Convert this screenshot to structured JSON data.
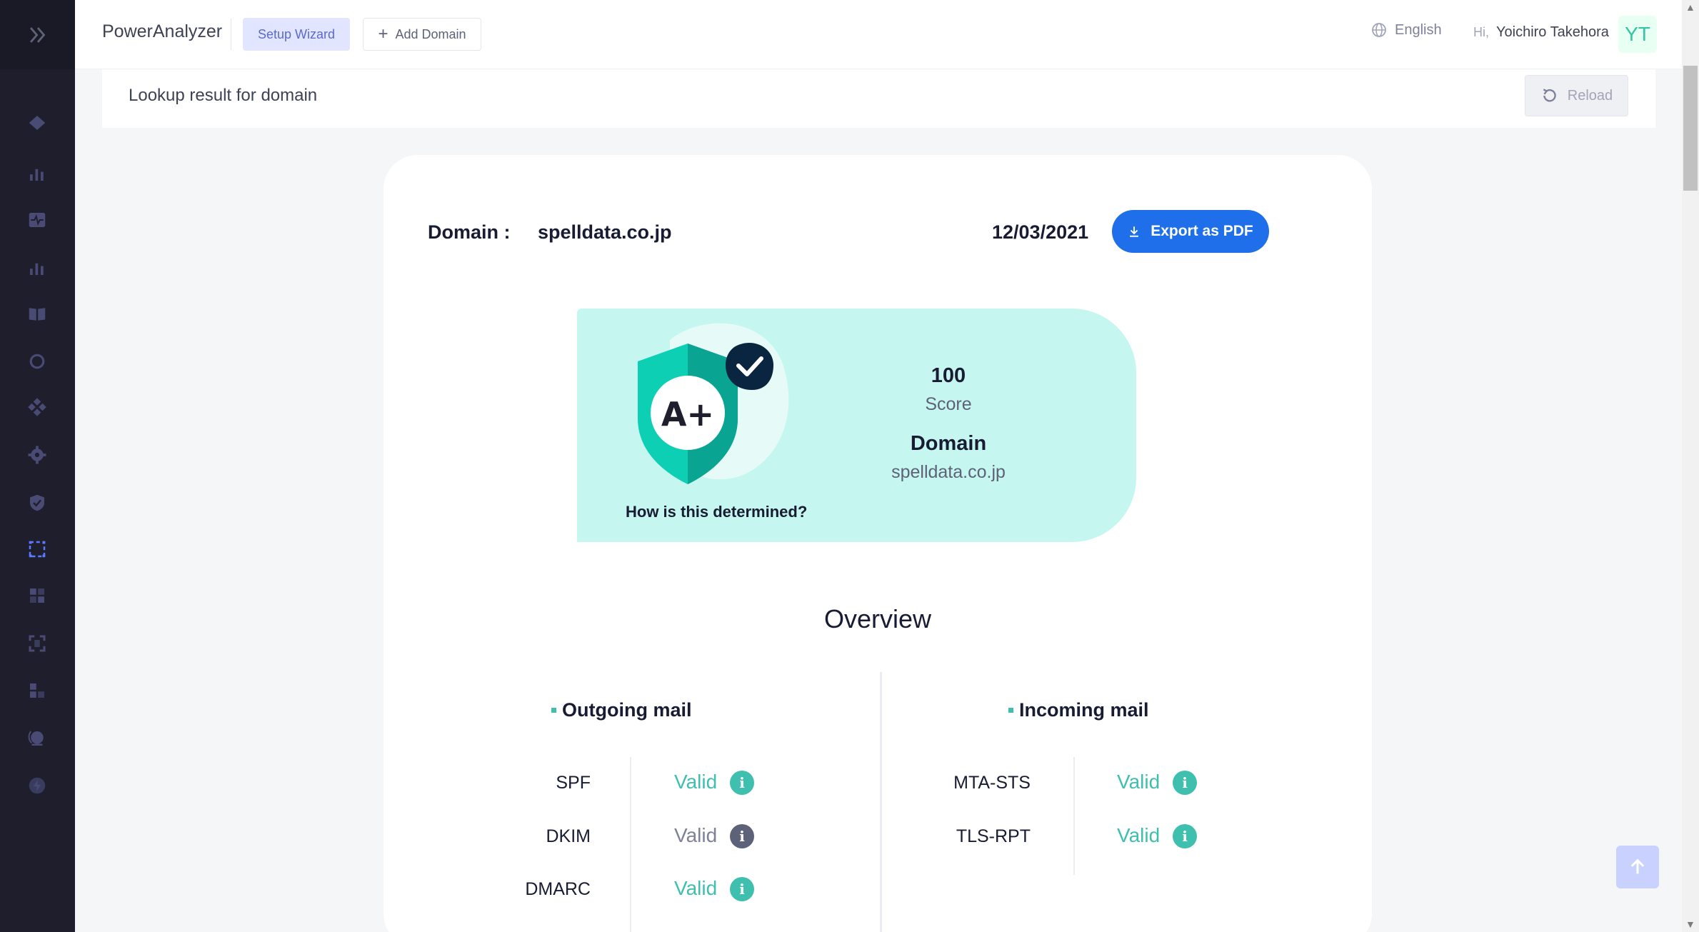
{
  "header": {
    "brand": "PowerAnalyzer",
    "setup_wizard_label": "Setup Wizard",
    "add_domain_label": "Add Domain",
    "language": "English",
    "greeting": "Hi,",
    "username": "Yoichiro Takehora",
    "avatar_initials": "YT"
  },
  "sidebar": {
    "icons": [
      "chevron-right-double-icon",
      "layers-icon",
      "bar-chart-icon",
      "pulse-icon",
      "bar-chart-icon",
      "book-icon",
      "target-icon",
      "diamond-icon",
      "gear-icon",
      "shield-check-icon",
      "scan-icon",
      "grid-icon",
      "scan-frame-icon",
      "layout-icon",
      "globe-icon",
      "bolt-icon"
    ]
  },
  "subheader": {
    "lookup_text": "Lookup result for domain",
    "reload_label": "Reload"
  },
  "result": {
    "domain_label": "Domain :",
    "domain_value": "spelldata.co.jp",
    "date": "12/03/2021",
    "export_label": "Export as PDF",
    "grade": "A+",
    "how_label": "How is this determined?",
    "score_value": "100",
    "score_label": "Score",
    "domain_title": "Domain",
    "domain_name": "spelldata.co.jp"
  },
  "overview": {
    "title": "Overview",
    "outgoing": {
      "title": "Outgoing mail",
      "rows": [
        {
          "label": "SPF",
          "status": "Valid",
          "state": "valid"
        },
        {
          "label": "DKIM",
          "status": "Valid",
          "state": "neutral"
        },
        {
          "label": "DMARC",
          "status": "Valid",
          "state": "valid"
        }
      ]
    },
    "incoming": {
      "title": "Incoming mail",
      "rows": [
        {
          "label": "MTA-STS",
          "status": "Valid",
          "state": "valid"
        },
        {
          "label": "TLS-RPT",
          "status": "Valid",
          "state": "valid"
        }
      ]
    }
  },
  "colors": {
    "sidebar_bg": "#1e1e2d",
    "accent_blue": "#1f6feb",
    "valid_green": "#3fbfad",
    "score_bg": "#c5f7f0"
  }
}
